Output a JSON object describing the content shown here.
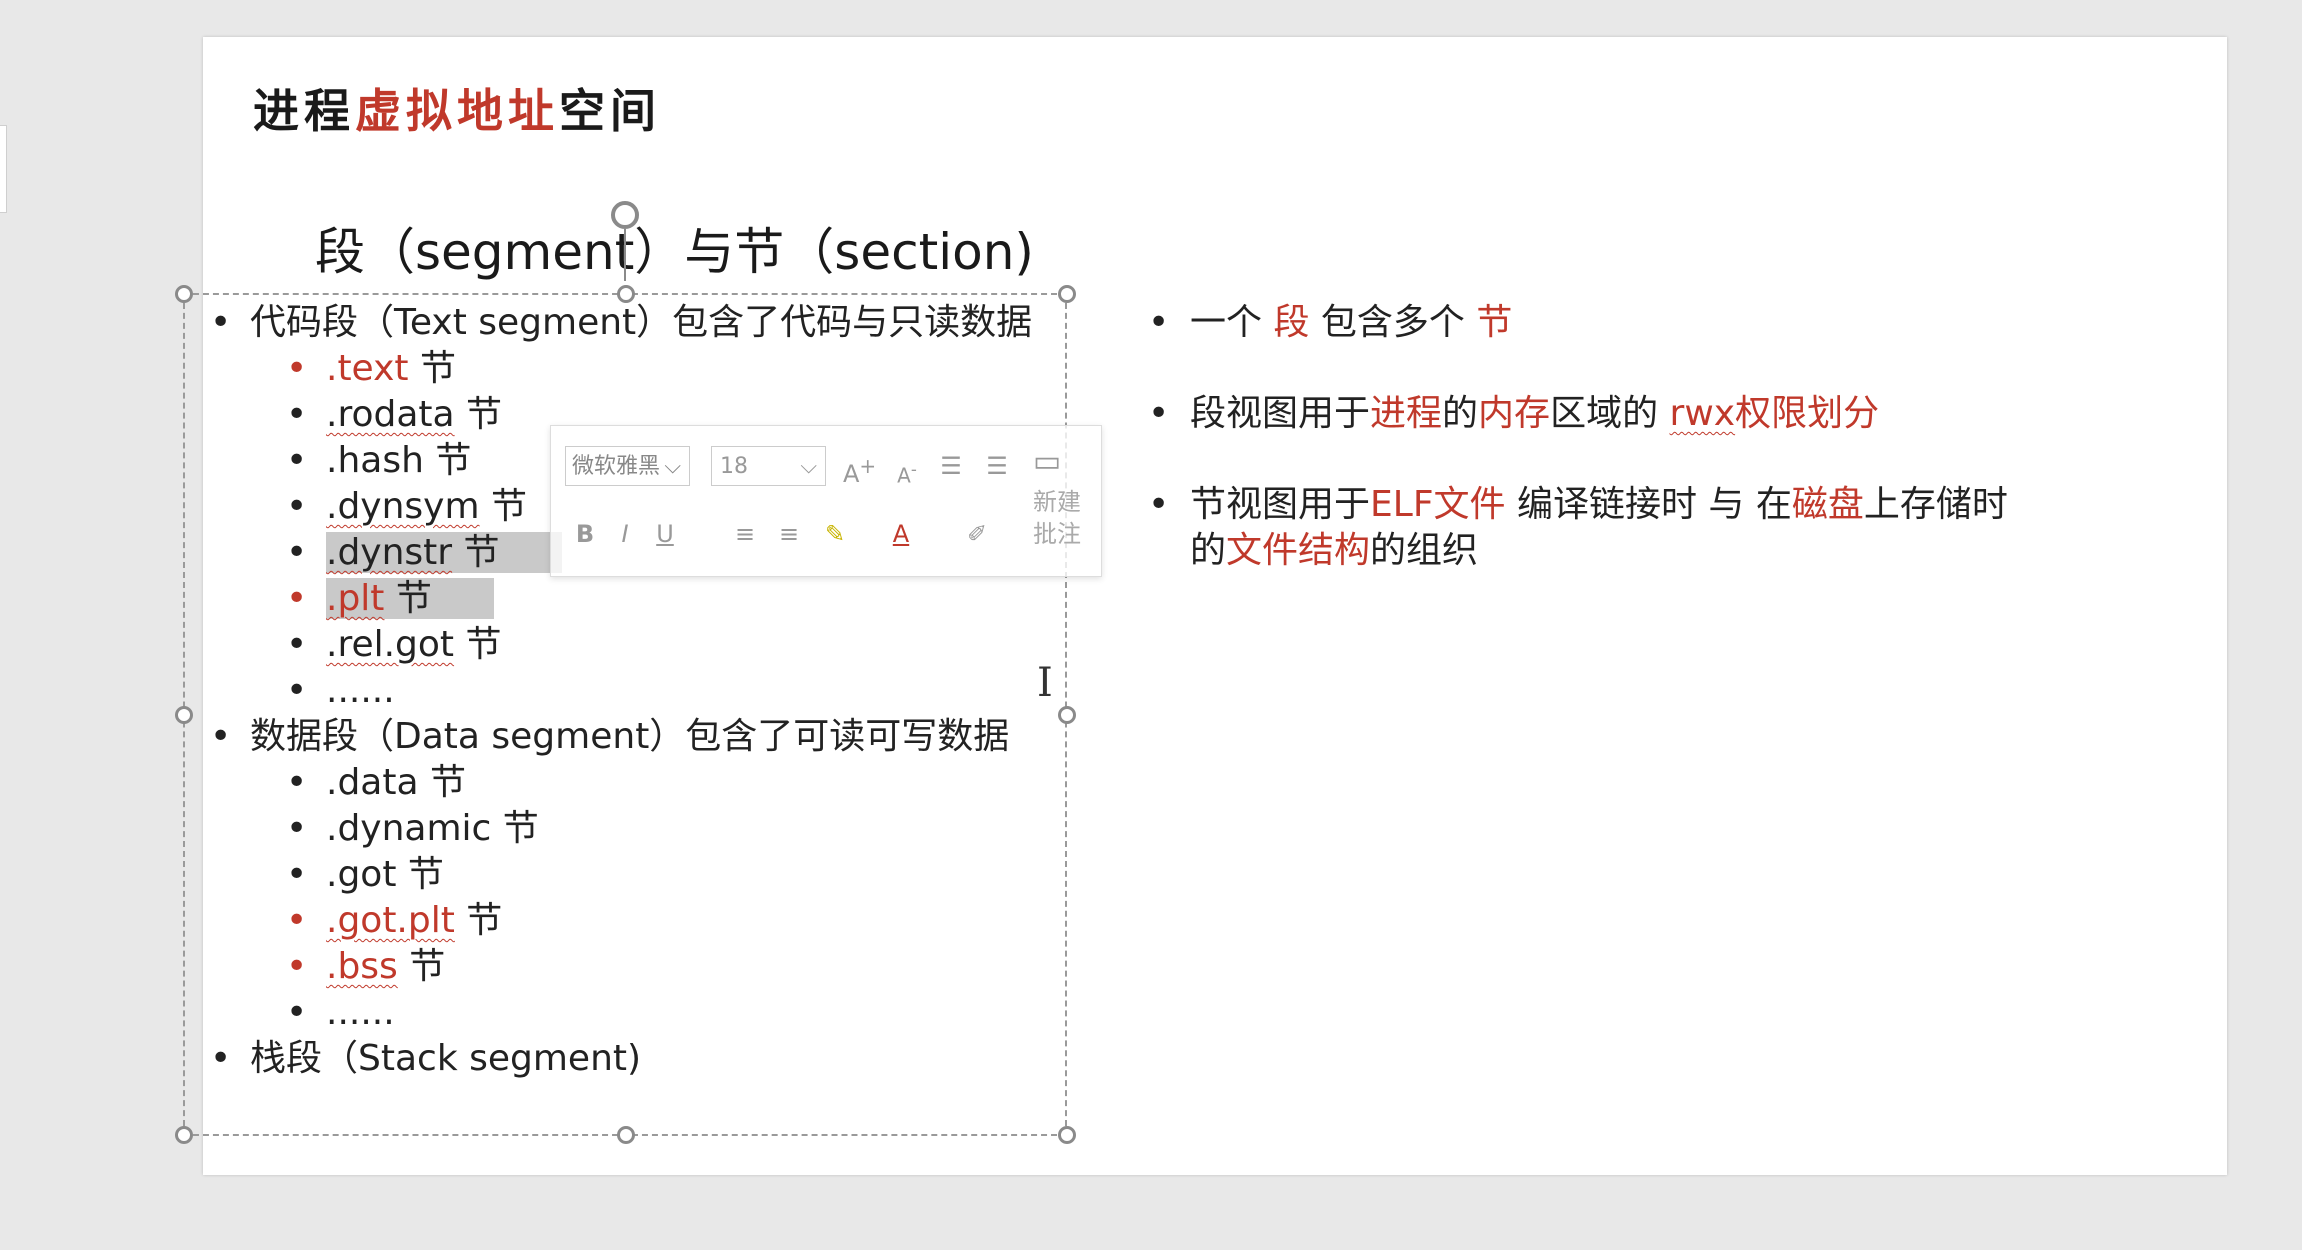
{
  "slide": {
    "title_prefix": "进程",
    "title_highlight": "虚拟地址",
    "title_suffix": "空间",
    "subtitle": "段（segment）与节（section)"
  },
  "left_list": [
    {
      "level": 1,
      "text": "代码段（Text segment）包含了代码与只读数据"
    },
    {
      "level": 2,
      "name": ".text",
      "suffix": " 节",
      "color": "red",
      "squiggle": false,
      "bullet_red": true
    },
    {
      "level": 2,
      "name": ".rodata",
      "suffix": " 节",
      "squiggle": true
    },
    {
      "level": 2,
      "name": ".hash",
      "suffix": " 节"
    },
    {
      "level": 2,
      "name": ".dynsym",
      "suffix": " 节",
      "squiggle": true
    },
    {
      "level": 2,
      "name": ".dynstr",
      "suffix": " 节",
      "squiggle": true,
      "highlight": true
    },
    {
      "level": 2,
      "name": ".plt",
      "suffix": " 节",
      "color": "red",
      "squiggle": true,
      "bullet_red": true,
      "highlight": true
    },
    {
      "level": 2,
      "name": ".rel.got",
      "suffix": " 节",
      "squiggle": true
    },
    {
      "level": 2,
      "name": "......",
      "suffix": ""
    },
    {
      "level": 1,
      "text": "数据段（Data segment）包含了可读可写数据"
    },
    {
      "level": 2,
      "name": ".data",
      "suffix": " 节"
    },
    {
      "level": 2,
      "name": ".dynamic",
      "suffix": " 节"
    },
    {
      "level": 2,
      "name": ".got",
      "suffix": " 节"
    },
    {
      "level": 2,
      "name": ".got.plt",
      "suffix": " 节",
      "color": "red",
      "squiggle": true,
      "bullet_red": true
    },
    {
      "level": 2,
      "name": ".bss",
      "suffix": " 节",
      "color": "red",
      "squiggle": true,
      "bullet_red": true
    },
    {
      "level": 2,
      "name": "......",
      "suffix": ""
    },
    {
      "level": 1,
      "text": "栈段（Stack segment)"
    }
  ],
  "right_list": [
    [
      {
        "t": "一个 "
      },
      {
        "t": "段",
        "red": true
      },
      {
        "t": " 包含多个 "
      },
      {
        "t": "节",
        "red": true
      }
    ],
    [
      {
        "t": "段视图用于"
      },
      {
        "t": "进程",
        "red": true
      },
      {
        "t": "的"
      },
      {
        "t": "内存",
        "red": true
      },
      {
        "t": "区域的 "
      },
      {
        "t": "rwx",
        "red": true,
        "sq": true
      },
      {
        "t": "权限划分",
        "red": true
      }
    ],
    [
      {
        "t": "节视图用于"
      },
      {
        "t": "ELF文件",
        "red": true
      },
      {
        "t": " 编译链接时 与 在"
      },
      {
        "t": "磁盘",
        "red": true
      },
      {
        "t": "上存储时 的"
      },
      {
        "t": "文件结构",
        "red": true
      },
      {
        "t": "的组织"
      }
    ]
  ],
  "toolbar": {
    "font_value": "微软雅黑",
    "size_value": "18",
    "grow_font": "A",
    "shrink_font": "A",
    "bold": "B",
    "italic": "I",
    "underline": "U",
    "font_color": "A",
    "new_comment_line1": "新建",
    "new_comment_line2": "批注"
  },
  "colors": {
    "accent_red": "#c0392b",
    "text": "#222222",
    "highlight": "#c9c9c9"
  }
}
